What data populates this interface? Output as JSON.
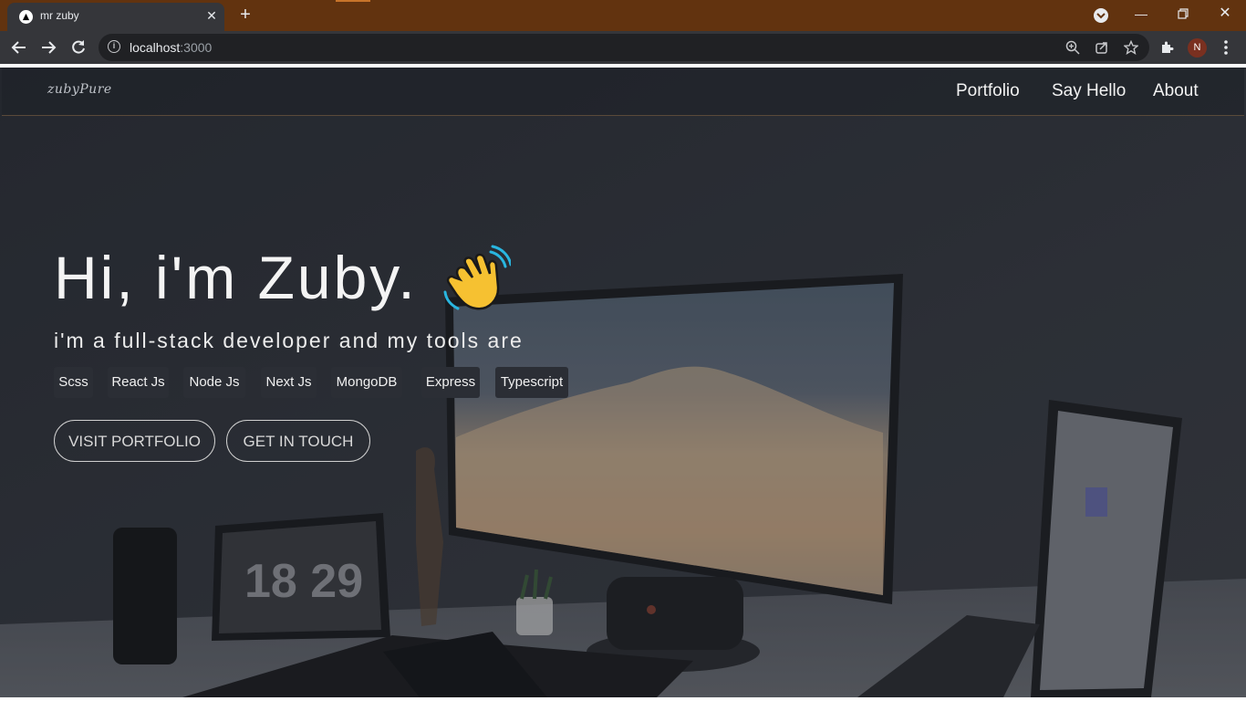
{
  "browser": {
    "tab_title": "mr zuby",
    "url_host": "localhost",
    "url_port": ":3000",
    "profile_initial": "N",
    "icons": [
      "next-favicon-icon",
      "close-icon",
      "plus-icon",
      "tab-search-icon",
      "minimize-icon",
      "restore-icon",
      "window-close-icon",
      "back-arrow-icon",
      "forward-arrow-icon",
      "reload-icon",
      "info-icon",
      "zoom-icon",
      "share-icon",
      "star-icon",
      "extensions-icon",
      "kebab-menu-icon"
    ]
  },
  "site": {
    "logo": "zubyPure",
    "nav": [
      "Portfolio",
      "Say Hello",
      "About"
    ],
    "hero": {
      "title": "Hi, i'm Zuby.",
      "subtitle": "i'm a full-stack developer and my tools are",
      "tools": [
        "Scss",
        "React Js",
        "Node Js",
        "Next Js",
        "MongoDB",
        "Express",
        "Typescript"
      ],
      "cta_portfolio": "VISIT PORTFOLIO",
      "cta_contact": "GET IN TOUCH"
    },
    "background": {
      "clock_text": "18 29"
    }
  },
  "colors": {
    "tabbar": "#62330f",
    "toolbar": "#35363a",
    "page_bg": "#22252c",
    "chip_bg": "#2b2e35"
  }
}
